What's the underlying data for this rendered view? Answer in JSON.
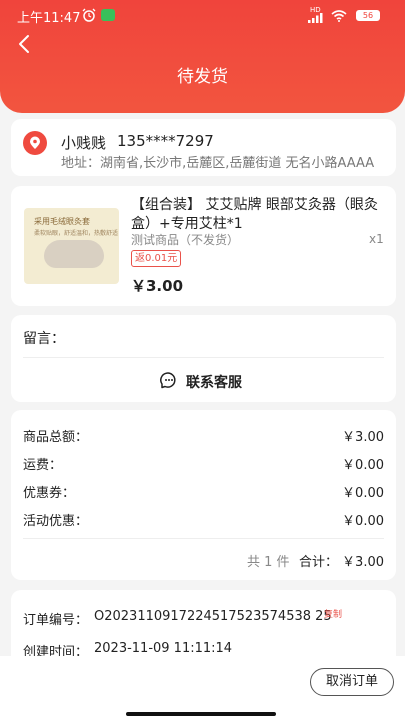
{
  "status_bar": {
    "time": "上午11:47",
    "hd": "HD",
    "battery": "56"
  },
  "header": {
    "title": "待发货",
    "back_icon": "chevron-left-icon"
  },
  "address": {
    "name": "小贱贱",
    "phone": "135****7297",
    "detail": "地址：湖南省,长沙市,岳麓区,岳麓街道 无名小路AAAA"
  },
  "product": {
    "image_text1": "采用毛绒眼灸套",
    "image_text2": "柔软贴眼，舒适温和，热敷舒适",
    "name": "【组合装】 艾艾贴牌 眼部艾灸器（眼灸盒）+专用艾柱*1",
    "spec": "测试商品（不发货）",
    "qty": "x1",
    "rebate": "返0.01元",
    "price": "￥3.00"
  },
  "message": {
    "label": "留言："
  },
  "contact": {
    "label": "联系客服",
    "icon": "customer-service-icon"
  },
  "summary": {
    "rows": [
      {
        "label": "商品总额：",
        "value": "￥3.00"
      },
      {
        "label": "运费：",
        "value": "￥0.00"
      },
      {
        "label": "优惠券：",
        "value": "￥0.00"
      },
      {
        "label": "活动优惠：",
        "value": "￥0.00"
      }
    ],
    "count": "共 1 件",
    "total_label": "合计：",
    "total_value": "￥3.00"
  },
  "order": {
    "no_label": "订单编号：",
    "no_value": "O2023110917224517523574538 25",
    "copy_label": "复制",
    "created_label": "创建时间：",
    "created_value": "2023-11-09 11:11:14"
  },
  "bottom": {
    "cancel_label": "取消订单"
  },
  "colors": {
    "accent": "#f0443c",
    "price_red": "#e9524a"
  }
}
